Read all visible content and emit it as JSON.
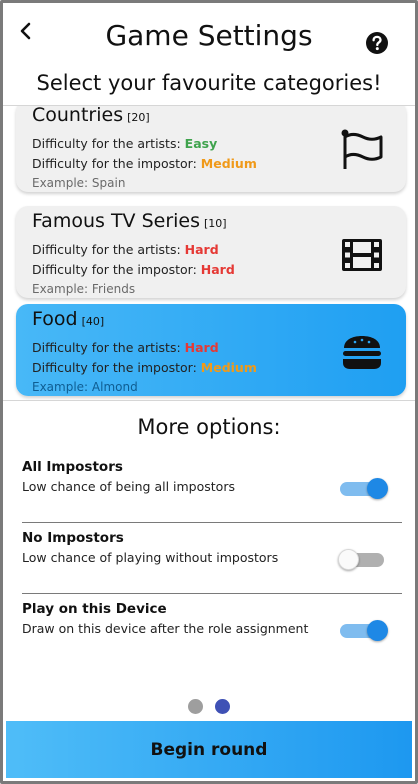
{
  "header": {
    "title": "Game Settings",
    "subtitle": "Select your favourite categories!"
  },
  "categories": [
    {
      "name": "Countries",
      "count": "[20]",
      "artists_label": "Difficulty for the artists: ",
      "artists_difficulty": "Easy",
      "impostor_label": "Difficulty for the impostor: ",
      "impostor_difficulty": "Medium",
      "example": "Example: Spain",
      "icon": "flag-icon",
      "selected": false
    },
    {
      "name": "Famous TV Series",
      "count": "[10]",
      "artists_label": "Difficulty for the artists: ",
      "artists_difficulty": "Hard",
      "impostor_label": "Difficulty for the impostor: ",
      "impostor_difficulty": "Hard",
      "example": "Example: Friends",
      "icon": "film-icon",
      "selected": false
    },
    {
      "name": "Food",
      "count": "[40]",
      "artists_label": "Difficulty for the artists: ",
      "artists_difficulty": "Hard",
      "impostor_label": "Difficulty for the impostor: ",
      "impostor_difficulty": "Medium",
      "example": "Example: Almond",
      "icon": "burger-icon",
      "selected": true
    }
  ],
  "difficulty_colors": {
    "Easy": "#3fa34d",
    "Medium": "#f09a1a",
    "Hard": "#e53935"
  },
  "more_options": {
    "title": "More options:",
    "options": [
      {
        "title": "All Impostors",
        "description": "Low chance of being all impostors",
        "enabled": true
      },
      {
        "title": "No Impostors",
        "description": "Low chance of playing without impostors",
        "enabled": false
      },
      {
        "title": "Play on this Device",
        "description": "Draw on this device after the role assignment",
        "enabled": true
      }
    ]
  },
  "pager": {
    "pages": 2,
    "active_index": 1
  },
  "footer": {
    "begin_label": "Begin round"
  },
  "colors": {
    "accent": "#1e88e5",
    "selected_card": "#2aa5f4",
    "pager_active": "#3f51b5"
  }
}
